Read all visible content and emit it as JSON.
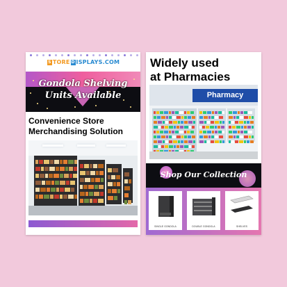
{
  "left_card": {
    "logo": {
      "part1": "TORE",
      "part2": "ISPLAYS",
      "part3": ".COM",
      "letter1": "S",
      "letter2": "D"
    },
    "banner_title_line1": "Gondola Shelving",
    "banner_title_line2": "Units Available",
    "subhead_line1": "Convenience Store",
    "subhead_line2": "Merchandising Solution"
  },
  "right_card": {
    "headline_line1": "Widely used",
    "headline_line2": "at Pharmacies",
    "pharmacy_sign": "Pharmacy",
    "collection_title": "Shop Our Collection",
    "products": [
      {
        "label": "SINGLE GONDOLA"
      },
      {
        "label": "DOUBLE GONDOLA"
      },
      {
        "label": "SHELVES"
      }
    ]
  },
  "colors": {
    "background": "#f2c9dc",
    "accent_purple": "#8c5ad2",
    "accent_pink": "#e368a9",
    "logo_orange": "#f39a22",
    "logo_blue": "#2a8bd1",
    "pharmacy_blue": "#1f4da8"
  }
}
